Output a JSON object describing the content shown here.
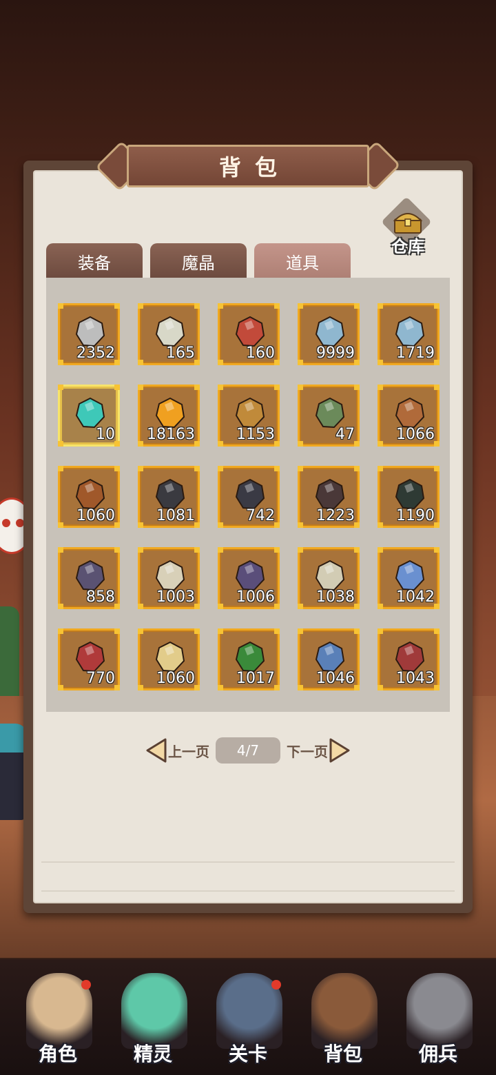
{
  "title": "背包",
  "warehouse_label": "仓库",
  "tabs": [
    {
      "label": "装备"
    },
    {
      "label": "魔晶"
    },
    {
      "label": "道具"
    }
  ],
  "active_tab": "道具",
  "items": [
    {
      "icon": "moonstone-icon",
      "count": "2352",
      "color": "#bdbdbd"
    },
    {
      "icon": "feather-branch-icon",
      "count": "165",
      "color": "#d8d8c8"
    },
    {
      "icon": "sword-shield-icon",
      "count": "160",
      "color": "#c24a3a"
    },
    {
      "icon": "mystery-chest-icon",
      "count": "9999",
      "color": "#8fb7cf"
    },
    {
      "icon": "mystery-chest-icon",
      "count": "1719",
      "color": "#8fb7cf"
    },
    {
      "icon": "teal-ticket-icon",
      "count": "10",
      "color": "#3ec8b8"
    },
    {
      "icon": "amber-crystal-icon",
      "count": "18163",
      "color": "#f0a020"
    },
    {
      "icon": "golden-hood-icon",
      "count": "1153",
      "color": "#c08a3a"
    },
    {
      "icon": "tribal-mask-icon",
      "count": "47",
      "color": "#6b8a5a"
    },
    {
      "icon": "tribal-mask-icon",
      "count": "1066",
      "color": "#b06a3a"
    },
    {
      "icon": "beast-mask-icon",
      "count": "1060",
      "color": "#a0582a"
    },
    {
      "icon": "dark-beast-icon",
      "count": "1081",
      "color": "#3a3a40"
    },
    {
      "icon": "dark-beast-icon",
      "count": "742",
      "color": "#3a3a44"
    },
    {
      "icon": "dark-beast-icon",
      "count": "1223",
      "color": "#4a3838"
    },
    {
      "icon": "dark-beast-icon",
      "count": "1190",
      "color": "#2e3a34"
    },
    {
      "icon": "purple-hood-icon",
      "count": "858",
      "color": "#5a5272"
    },
    {
      "icon": "white-hood-icon",
      "count": "1003",
      "color": "#d8d0b8"
    },
    {
      "icon": "purple-hood-icon",
      "count": "1006",
      "color": "#5a4e7a"
    },
    {
      "icon": "white-hood-icon",
      "count": "1038",
      "color": "#d2ccb4"
    },
    {
      "icon": "blue-crystal-icon",
      "count": "1042",
      "color": "#6a90d0"
    },
    {
      "icon": "crimson-crystal-icon",
      "count": "770",
      "color": "#b03a3a"
    },
    {
      "icon": "gold-ore-icon",
      "count": "1060",
      "color": "#e2cc8a"
    },
    {
      "icon": "green-crystal-icon",
      "count": "1017",
      "color": "#3a8a3a"
    },
    {
      "icon": "blue-swirl-icon",
      "count": "1046",
      "color": "#5a80b8"
    },
    {
      "icon": "red-swirl-icon",
      "count": "1043",
      "color": "#a03a3a"
    }
  ],
  "selected_index": 5,
  "pager": {
    "prev_label": "上一页",
    "next_label": "下一页",
    "page_indicator": "4/7"
  },
  "bottom_nav": [
    {
      "label": "角色",
      "icon": "hero-icon",
      "color": "#d8b890",
      "badge": true
    },
    {
      "label": "精灵",
      "icon": "spirit-slime-icon",
      "color": "#5ec8a8",
      "badge": false
    },
    {
      "label": "关卡",
      "icon": "stage-gate-icon",
      "color": "#5a6e8a",
      "badge": true
    },
    {
      "label": "背包",
      "icon": "backpack-icon",
      "color": "#8a5a3a",
      "badge": false
    },
    {
      "label": "佣兵",
      "icon": "knight-helmet-icon",
      "color": "#8a8a90",
      "badge": false
    }
  ]
}
